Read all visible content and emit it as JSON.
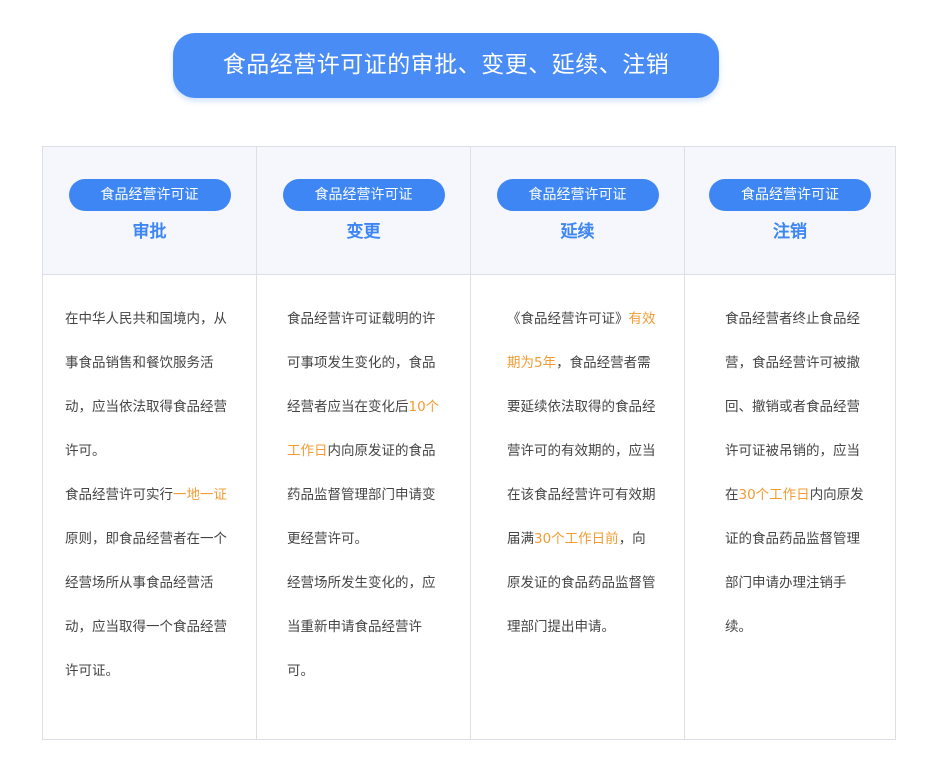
{
  "title": "食品经营许可证的审批、变更、延续、注销",
  "colors": {
    "accent": "#3d86f4",
    "highlight": "#f39c33"
  },
  "columns": [
    {
      "badge": "食品经营许可证",
      "heading": "审批",
      "p1": "在中华人民共和国境内，从事食品销售和餐饮服务活动，应当依法取得食品经营许可。",
      "p2_a": "食品经营许可实行",
      "p2_hl": "一地一证",
      "p2_b": "原则，即食品经营者在一个经营场所从事食品经营活动，应当取得一个食品经营许可证。"
    },
    {
      "badge": "食品经营许可证",
      "heading": "变更",
      "p1_a": "食品经营许可证载明的许可事项发生变化的，食品经营者应当在变化后",
      "p1_hl": "10个工作日",
      "p1_b": "内向原发证的食品药品监督管理部门申请变更经营许可。",
      "p2": "经营场所发生变化的，应当重新申请食品经营许可。"
    },
    {
      "badge": "食品经营许可证",
      "heading": "延续",
      "p1_a": "《食品经营许可证》",
      "p1_hl1": "有效期为5年",
      "p1_b": "，食品经营者需要延续依法取得的食品经营许可的有效期的，应当在该食品经营许可有效期届满",
      "p1_hl2": "30个工作日前",
      "p1_c": "，向原发证的食品药品监督管理部门提出申请。"
    },
    {
      "badge": "食品经营许可证",
      "heading": "注销",
      "p1_a": "食品经营者终止食品经营，食品经营许可被撤回、撤销或者食品经营许可证被吊销的，应当在",
      "p1_hl": "30个工作日",
      "p1_b": "内向原发证的食品药品监督管理部门申请办理注销手续。"
    }
  ]
}
